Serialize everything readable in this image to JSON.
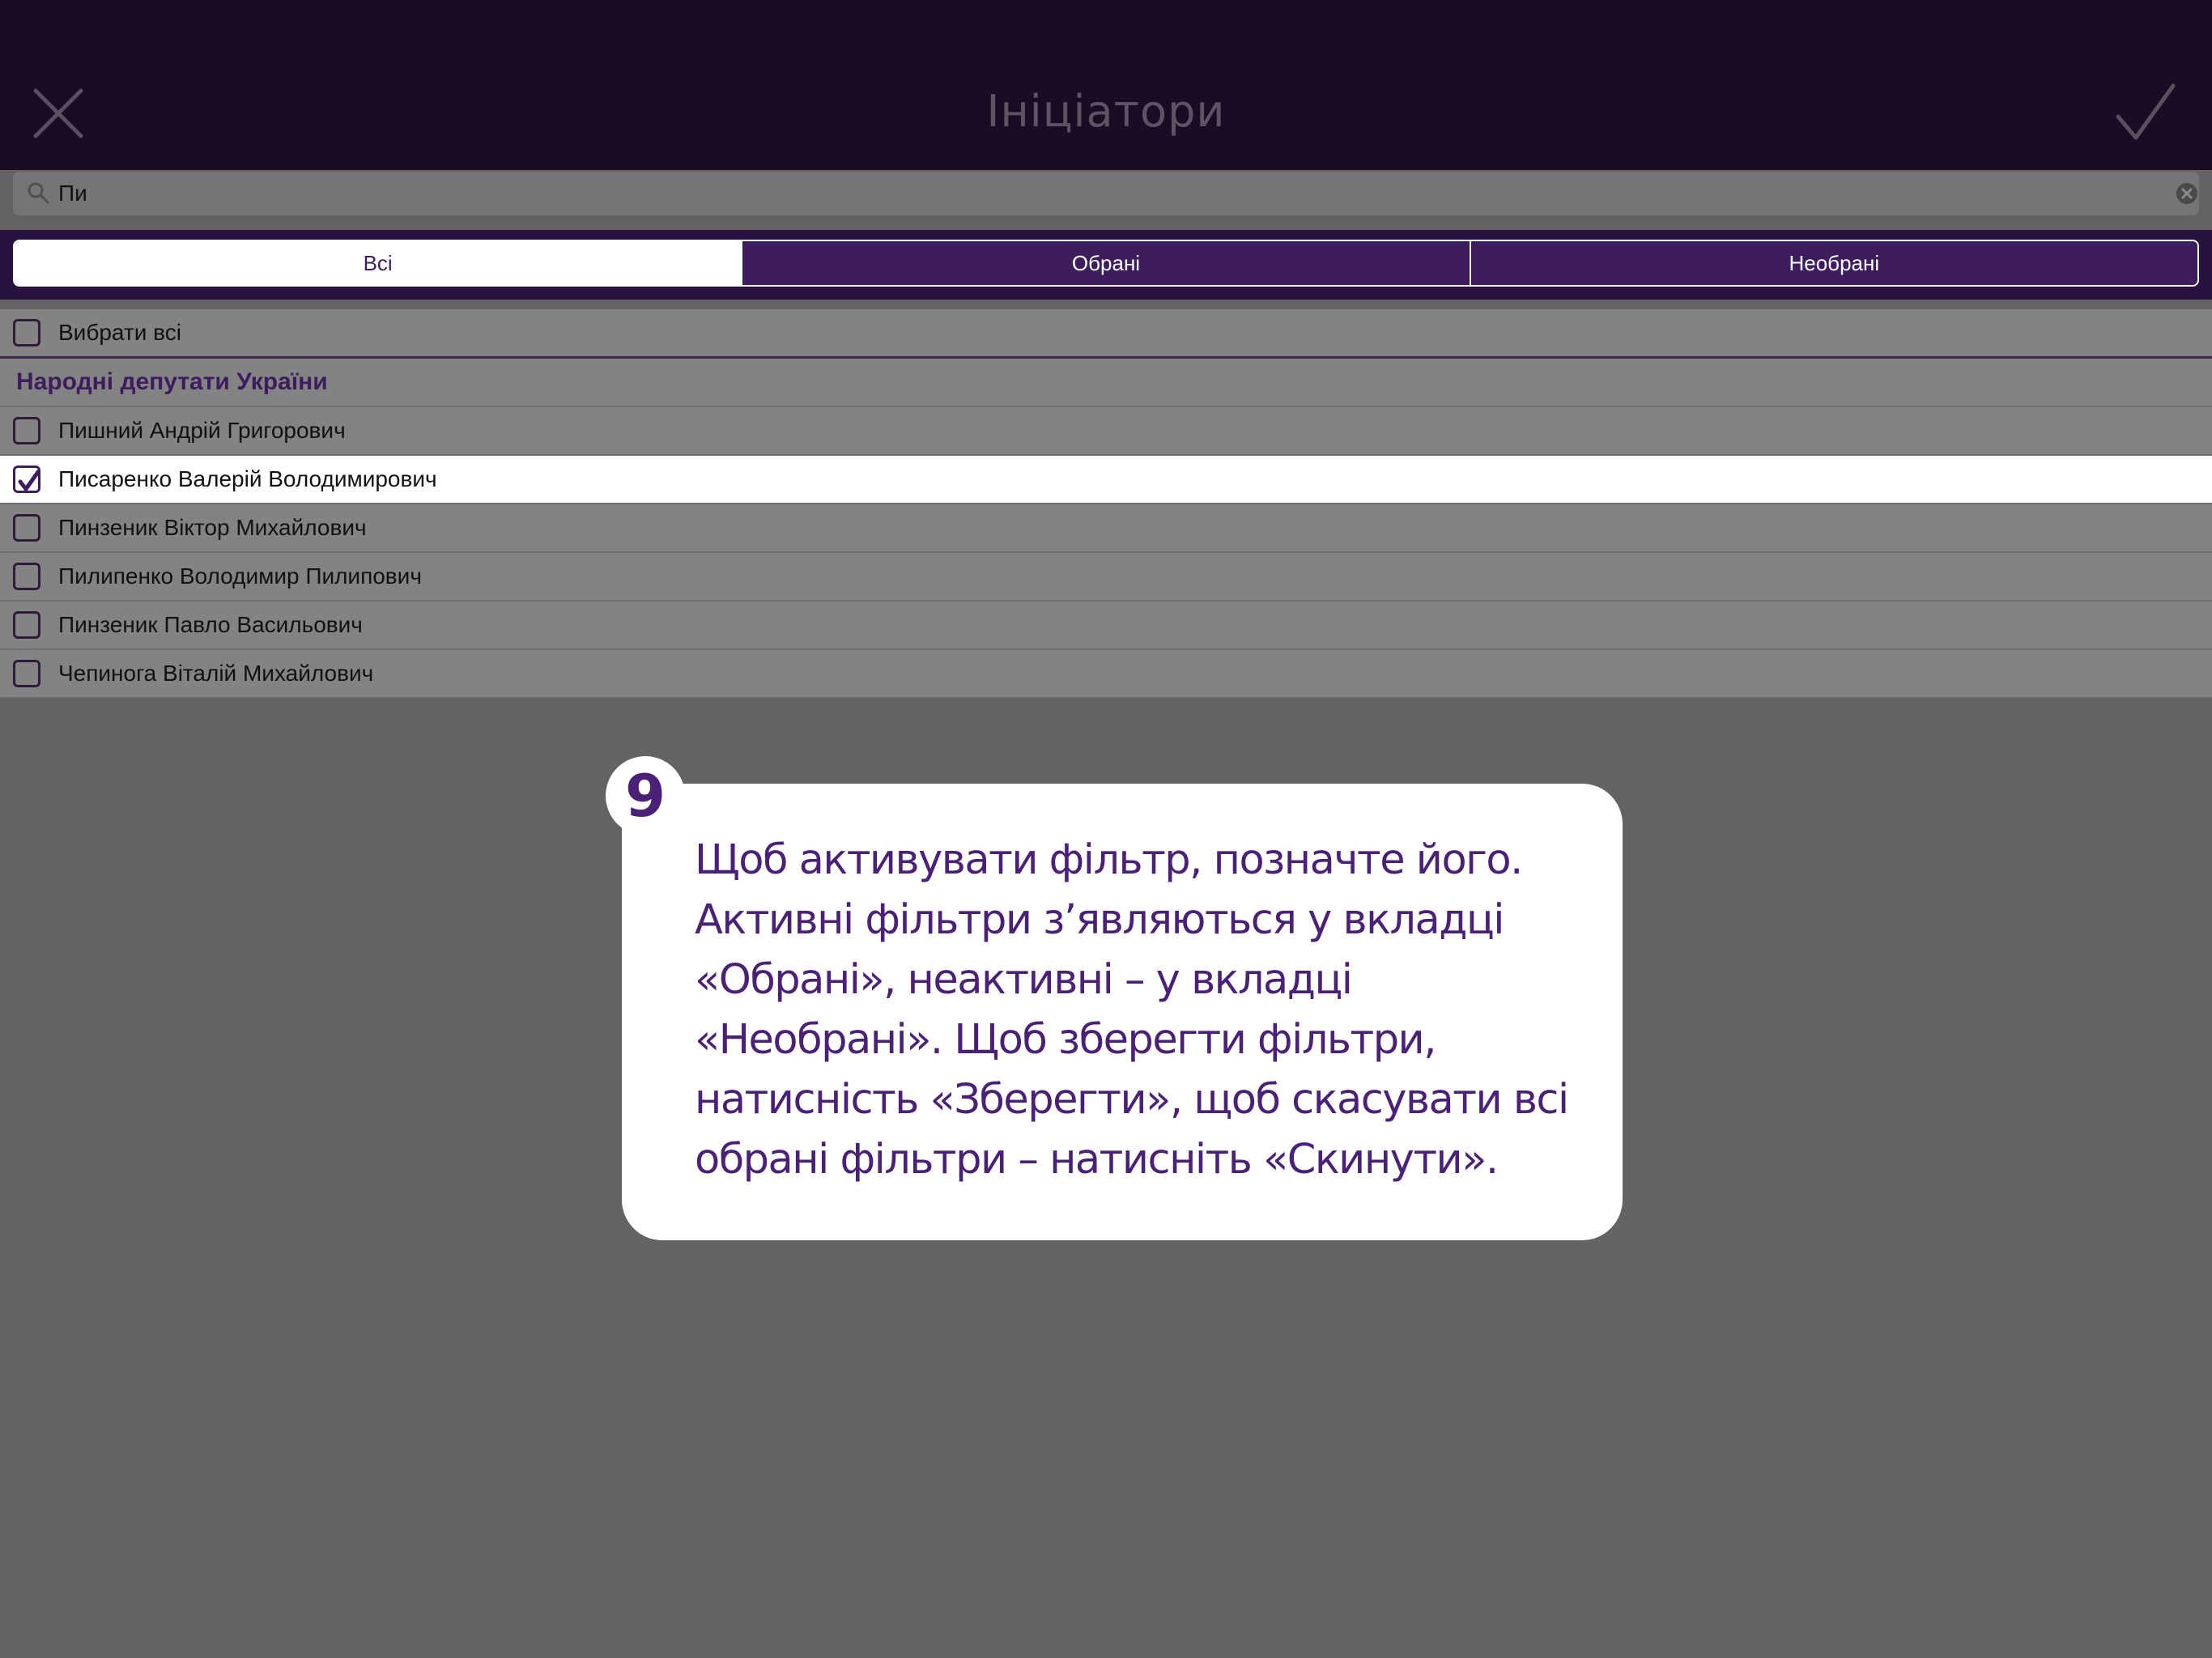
{
  "header": {
    "title": "Ініціатори",
    "close_icon": "close-icon",
    "confirm_icon": "checkmark-icon"
  },
  "search": {
    "value": "Пи",
    "icon": "search-icon",
    "clear_icon": "clear-icon"
  },
  "tabs": [
    {
      "label": "Всі",
      "active": true
    },
    {
      "label": "Обрані",
      "active": false
    },
    {
      "label": "Необрані",
      "active": false
    }
  ],
  "select_all": {
    "label": "Вибрати всі",
    "checked": false
  },
  "section": {
    "title": "Народні депутати України"
  },
  "items": [
    {
      "label": "Пишний Андрій Григорович",
      "checked": false
    },
    {
      "label": "Писаренко Валерій Володимирович",
      "checked": true
    },
    {
      "label": "Пинзеник Віктор Михайлович",
      "checked": false
    },
    {
      "label": "Пилипенко Володимир Пилипович",
      "checked": false
    },
    {
      "label": "Пинзеник Павло Васильович",
      "checked": false
    },
    {
      "label": "Чепинога Віталій Михайлович",
      "checked": false
    }
  ],
  "callout": {
    "step": "9",
    "text": "Щоб активувати фільтр, позначте його. Активні фільтри з’являються у вкладці «Обрані», неактивні – у вкладці «Необрані». Щоб зберегти фільтри, натисність «Зберегти», щоб скасувати всі обрані фільтри – натисніть «Скинути»."
  },
  "colors": {
    "header_bg": "#1b0c26",
    "accent": "#3e1d5e",
    "callout_text": "#4b2178",
    "overlay": "#636363"
  }
}
